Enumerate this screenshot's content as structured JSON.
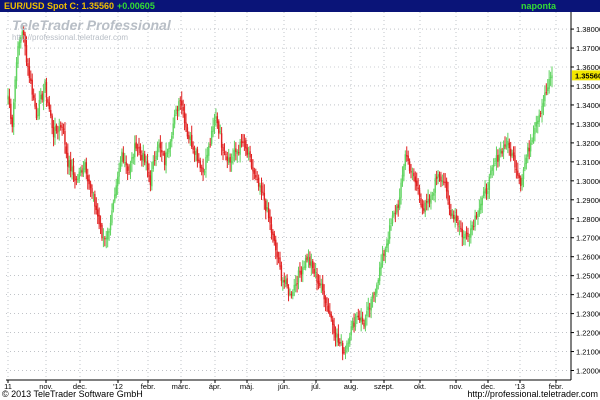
{
  "header": {
    "title": "EUR/USD Spot C: 1.35560",
    "change": "+0.00605",
    "period": "naponta"
  },
  "watermark": {
    "brand": "TeleTrader Professional",
    "url": "http://professional.teletrader.com"
  },
  "footer": {
    "copyright": "© 2013 TeleTrader Software GmbH",
    "url": "http://professional.teletrader.com"
  },
  "colors": {
    "up": "#5fd35f",
    "down": "#e02020",
    "header_bg": "#0a1478",
    "price_tag_bg": "#f2e600"
  },
  "chart_data": {
    "type": "candlestick",
    "series_name": "EUR/USD Spot",
    "y_axis_side": "right",
    "ylim": [
      1.195,
      1.389
    ],
    "y_ticks": [
      "1.38000",
      "1.37000",
      "1.36000",
      "1.35000",
      "1.34000",
      "1.33000",
      "1.32000",
      "1.31000",
      "1.30000",
      "1.29000",
      "1.28000",
      "1.27000",
      "1.26000",
      "1.25000",
      "1.24000",
      "1.23000",
      "1.22000",
      "1.21000",
      "1.20000"
    ],
    "current_price": "1.35560",
    "x_labels": [
      "11",
      "nov.",
      "dec.",
      "'12",
      "febr.",
      "márc.",
      "ápr.",
      "máj.",
      "jún.",
      "júl.",
      "aug.",
      "szept.",
      "okt.",
      "nov.",
      "dec.",
      "'13",
      "febr."
    ],
    "grid": true,
    "anchors": [
      [
        0,
        1.345
      ],
      [
        3,
        1.33
      ],
      [
        6,
        1.365
      ],
      [
        10,
        1.38
      ],
      [
        14,
        1.36
      ],
      [
        20,
        1.335
      ],
      [
        26,
        1.35
      ],
      [
        32,
        1.325
      ],
      [
        38,
        1.33
      ],
      [
        42,
        1.31
      ],
      [
        48,
        1.3
      ],
      [
        54,
        1.31
      ],
      [
        58,
        1.295
      ],
      [
        62,
        1.285
      ],
      [
        66,
        1.27
      ],
      [
        70,
        1.272
      ],
      [
        75,
        1.29
      ],
      [
        80,
        1.315
      ],
      [
        85,
        1.305
      ],
      [
        90,
        1.32
      ],
      [
        96,
        1.31
      ],
      [
        100,
        1.3
      ],
      [
        105,
        1.32
      ],
      [
        110,
        1.31
      ],
      [
        116,
        1.33
      ],
      [
        121,
        1.345
      ],
      [
        126,
        1.325
      ],
      [
        132,
        1.315
      ],
      [
        137,
        1.305
      ],
      [
        142,
        1.32
      ],
      [
        146,
        1.335
      ],
      [
        150,
        1.32
      ],
      [
        156,
        1.31
      ],
      [
        160,
        1.315
      ],
      [
        165,
        1.32
      ],
      [
        170,
        1.31
      ],
      [
        174,
        1.3
      ],
      [
        180,
        1.29
      ],
      [
        186,
        1.27
      ],
      [
        192,
        1.25
      ],
      [
        198,
        1.24
      ],
      [
        204,
        1.25
      ],
      [
        210,
        1.26
      ],
      [
        216,
        1.25
      ],
      [
        222,
        1.24
      ],
      [
        228,
        1.225
      ],
      [
        232,
        1.215
      ],
      [
        236,
        1.21
      ],
      [
        240,
        1.22
      ],
      [
        245,
        1.23
      ],
      [
        250,
        1.225
      ],
      [
        255,
        1.235
      ],
      [
        260,
        1.25
      ],
      [
        265,
        1.265
      ],
      [
        270,
        1.28
      ],
      [
        275,
        1.29
      ],
      [
        279,
        1.315
      ],
      [
        283,
        1.305
      ],
      [
        288,
        1.295
      ],
      [
        292,
        1.285
      ],
      [
        297,
        1.29
      ],
      [
        302,
        1.305
      ],
      [
        306,
        1.3
      ],
      [
        310,
        1.285
      ],
      [
        315,
        1.28
      ],
      [
        320,
        1.27
      ],
      [
        325,
        1.275
      ],
      [
        330,
        1.285
      ],
      [
        336,
        1.295
      ],
      [
        340,
        1.305
      ],
      [
        345,
        1.315
      ],
      [
        350,
        1.32
      ],
      [
        356,
        1.31
      ],
      [
        360,
        1.3
      ],
      [
        365,
        1.315
      ],
      [
        370,
        1.33
      ],
      [
        375,
        1.34
      ],
      [
        382,
        1.356
      ]
    ]
  }
}
